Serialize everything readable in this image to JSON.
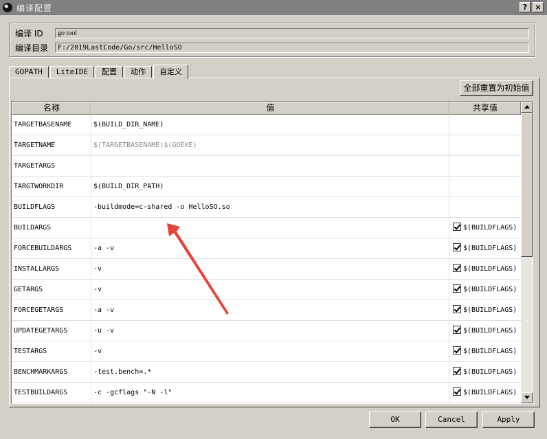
{
  "window": {
    "title": "编译配置",
    "help_button": "?",
    "close_button": "×"
  },
  "info": {
    "id_label": "编译 ID",
    "id_value": "go tool",
    "dir_label": "编译目录",
    "dir_value": "F:/2019LastCode/Go/src/HelloSO"
  },
  "tabs": [
    {
      "label": "GOPATH"
    },
    {
      "label": "LiteIDE"
    },
    {
      "label": "配置"
    },
    {
      "label": "动作"
    },
    {
      "label": "自定义"
    }
  ],
  "active_tab": "自定义",
  "reset_button": "全部重置为初始值",
  "table": {
    "headers": [
      "名称",
      "值",
      "共享值"
    ],
    "rows": [
      {
        "name": "TARGETBASENAME",
        "value": "$(BUILD_DIR_NAME)",
        "shared": "",
        "checked": false,
        "muted": false
      },
      {
        "name": "TARGETNAME",
        "value": "$(TARGETBASENAME)$(GOEXE)",
        "shared": "",
        "checked": false,
        "muted": true
      },
      {
        "name": "TARGETARGS",
        "value": "",
        "shared": "",
        "checked": false,
        "muted": false
      },
      {
        "name": "TARGTWORKDIR",
        "value": "$(BUILD_DIR_PATH)",
        "shared": "",
        "checked": false,
        "muted": false
      },
      {
        "name": "BUILDFLAGS",
        "value": "-buildmode=c-shared -o HelloSO.so",
        "shared": "",
        "checked": false,
        "muted": false
      },
      {
        "name": "BUILDARGS",
        "value": "",
        "shared": "$(BUILDFLAGS)",
        "checked": true,
        "muted": false
      },
      {
        "name": "FORCEBUILDARGS",
        "value": "-a -v",
        "shared": "$(BUILDFLAGS)",
        "checked": true,
        "muted": false
      },
      {
        "name": "INSTALLARGS",
        "value": "-v",
        "shared": "$(BUILDFLAGS)",
        "checked": true,
        "muted": false
      },
      {
        "name": "GETARGS",
        "value": "-v",
        "shared": "$(BUILDFLAGS)",
        "checked": true,
        "muted": false
      },
      {
        "name": "FORCEGETARGS",
        "value": "-a -v",
        "shared": "$(BUILDFLAGS)",
        "checked": true,
        "muted": false
      },
      {
        "name": "UPDATEGETARGS",
        "value": "-u -v",
        "shared": "$(BUILDFLAGS)",
        "checked": true,
        "muted": false
      },
      {
        "name": "TESTARGS",
        "value": "-v",
        "shared": "$(BUILDFLAGS)",
        "checked": true,
        "muted": false
      },
      {
        "name": "BENCHMARKARGS",
        "value": "-test.bench=.*",
        "shared": "$(BUILDFLAGS)",
        "checked": true,
        "muted": false
      },
      {
        "name": "TESTBUILDARGS",
        "value": "-c -gcflags \"-N -l\"",
        "shared": "$(BUILDFLAGS)",
        "checked": true,
        "muted": false
      }
    ]
  },
  "buttons": {
    "ok": "OK",
    "cancel": "Cancel",
    "apply": "Apply"
  },
  "colors": {
    "annotation_arrow": "#e8423a",
    "titlebar": "#808080",
    "dialog_bg": "#d4d0c8"
  }
}
